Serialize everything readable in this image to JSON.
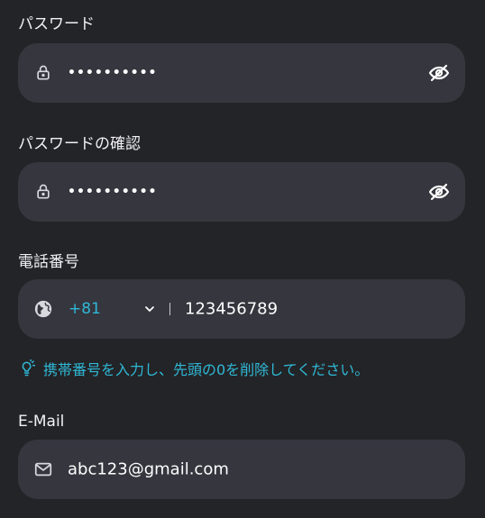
{
  "password": {
    "label": "パスワード",
    "value": "••••••••••"
  },
  "confirm_password": {
    "label": "パスワードの確認",
    "value": "••••••••••"
  },
  "phone": {
    "label": "電話番号",
    "country_code": "+81",
    "number": "123456789",
    "hint": "携帯番号を入力し、先頭の0を削除してください。"
  },
  "email": {
    "label": "E-Mail",
    "value": "abc123@gmail.com"
  },
  "colors": {
    "background": "#232427",
    "field": "#36363f",
    "accent": "#2fb8d6",
    "text": "#ffffff"
  }
}
